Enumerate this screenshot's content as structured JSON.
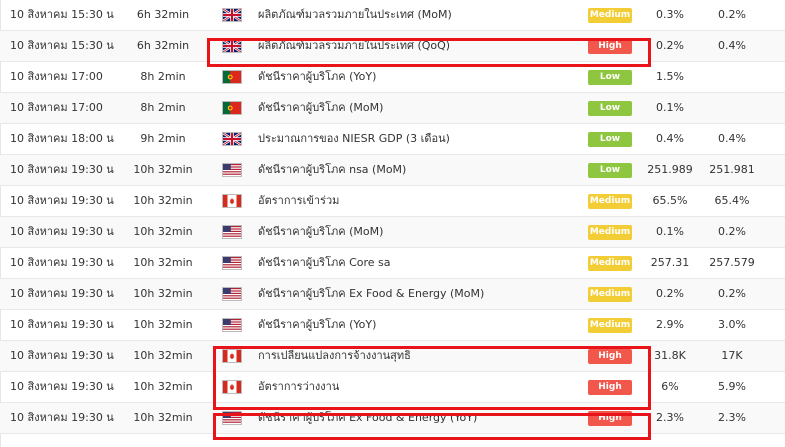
{
  "colors": {
    "high": "#f2574b",
    "medium": "#f3cd35",
    "low": "#8ec63f",
    "highlight": "#e8141a"
  },
  "rows": [
    {
      "date": "10 สิงหาคม 15:30 น",
      "remaining": "6h 32min",
      "flag": "gb-flag-icon",
      "event": "ผลิตภัณฑ์มวลรวมภายในประเทศ (MoM)",
      "impact": "Medium",
      "actual": "0.3%",
      "forecast": "0.2%"
    },
    {
      "date": "10 สิงหาคม 15:30 น",
      "remaining": "6h 32min",
      "flag": "gb-flag-icon",
      "event": "ผลิตภัณฑ์มวลรวมภายในประเทศ (QoQ)",
      "impact": "High",
      "actual": "0.2%",
      "forecast": "0.4%"
    },
    {
      "date": "10 สิงหาคม 17:00",
      "remaining": "8h 2min",
      "flag": "pt-flag-icon",
      "event": "ดัชนีราคาผู้บริโภค (YoY)",
      "impact": "Low",
      "actual": "1.5%",
      "forecast": ""
    },
    {
      "date": "10 สิงหาคม 17:00",
      "remaining": "8h 2min",
      "flag": "pt-flag-icon",
      "event": "ดัชนีราคาผู้บริโภค (MoM)",
      "impact": "Low",
      "actual": "0.1%",
      "forecast": ""
    },
    {
      "date": "10 สิงหาคม 18:00 น",
      "remaining": "9h 2min",
      "flag": "gb-flag-icon",
      "event": "ประมาณการของ NIESR GDP (3 เดือน)",
      "impact": "Low",
      "actual": "0.4%",
      "forecast": "0.4%"
    },
    {
      "date": "10 สิงหาคม 19:30 น",
      "remaining": "10h 32min",
      "flag": "us-flag-icon",
      "event": "ดัชนีราคาผู้บริโภค nsa (MoM)",
      "impact": "Low",
      "actual": "251.989",
      "forecast": "251.981"
    },
    {
      "date": "10 สิงหาคม 19:30 น",
      "remaining": "10h 32min",
      "flag": "ca-flag-icon",
      "event": "อัตราการเข้าร่วม",
      "impact": "Medium",
      "actual": "65.5%",
      "forecast": "65.4%"
    },
    {
      "date": "10 สิงหาคม 19:30 น",
      "remaining": "10h 32min",
      "flag": "us-flag-icon",
      "event": "ดัชนีราคาผู้บริโภค (MoM)",
      "impact": "Medium",
      "actual": "0.1%",
      "forecast": "0.2%"
    },
    {
      "date": "10 สิงหาคม 19:30 น",
      "remaining": "10h 32min",
      "flag": "us-flag-icon",
      "event": "ดัชนีราคาผู้บริโภค Core sa",
      "impact": "Medium",
      "actual": "257.31",
      "forecast": "257.579"
    },
    {
      "date": "10 สิงหาคม 19:30 น",
      "remaining": "10h 32min",
      "flag": "us-flag-icon",
      "event": "ดัชนีราคาผู้บริโภค Ex Food & Energy (MoM)",
      "impact": "Medium",
      "actual": "0.2%",
      "forecast": "0.2%"
    },
    {
      "date": "10 สิงหาคม 19:30 น",
      "remaining": "10h 32min",
      "flag": "us-flag-icon",
      "event": "ดัชนีราคาผู้บริโภค (YoY)",
      "impact": "Medium",
      "actual": "2.9%",
      "forecast": "3.0%"
    },
    {
      "date": "10 สิงหาคม 19:30 น",
      "remaining": "10h 32min",
      "flag": "ca-flag-icon",
      "event": "การเปลี่ยนแปลงการจ้างงานสุทธิ",
      "impact": "High",
      "actual": "31.8K",
      "forecast": "17K"
    },
    {
      "date": "10 สิงหาคม 19:30 น",
      "remaining": "10h 32min",
      "flag": "ca-flag-icon",
      "event": "อัตราการว่างงาน",
      "impact": "High",
      "actual": "6%",
      "forecast": "5.9%"
    },
    {
      "date": "10 สิงหาคม 19:30 น",
      "remaining": "10h 32min",
      "flag": "us-flag-icon",
      "event": "ดัชนีราคาผู้บริโภค Ex Food & Energy (YoY)",
      "impact": "High",
      "actual": "2.3%",
      "forecast": "2.3%"
    }
  ]
}
